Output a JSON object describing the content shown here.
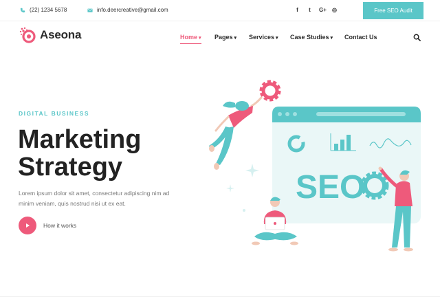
{
  "topbar": {
    "phone": "(22) 1234 5678",
    "email": "info.deercreative@gmail.com",
    "social_icons": [
      "facebook-icon",
      "twitter-icon",
      "google-plus-icon",
      "instagram-icon"
    ],
    "social_glyphs": [
      "f",
      "t",
      "G+",
      "◎"
    ],
    "cta_label": "Free SEO Audit"
  },
  "brand": {
    "name": "Aseona"
  },
  "nav": {
    "items": [
      {
        "label": "Home",
        "caret": "▾",
        "active": true
      },
      {
        "label": "Pages",
        "caret": "▾"
      },
      {
        "label": "Services",
        "caret": "▾"
      },
      {
        "label": "Case Studies",
        "caret": "▾"
      },
      {
        "label": "Contact Us"
      }
    ]
  },
  "hero": {
    "kicker": "DIGITAL BUSINESS",
    "title_line1": "Marketing",
    "title_line2": "Strategy",
    "description": "Lorem ipsum dolor sit amet, consectetur adipiscing nim ad minim veniam, quis nostrud nisi ut ex eat.",
    "video_label": "How it works",
    "illustration_text": "SEO"
  },
  "colors": {
    "accent": "#ee5a7b",
    "teal": "#5ac6c8",
    "light_teal": "#eaf7f7"
  }
}
